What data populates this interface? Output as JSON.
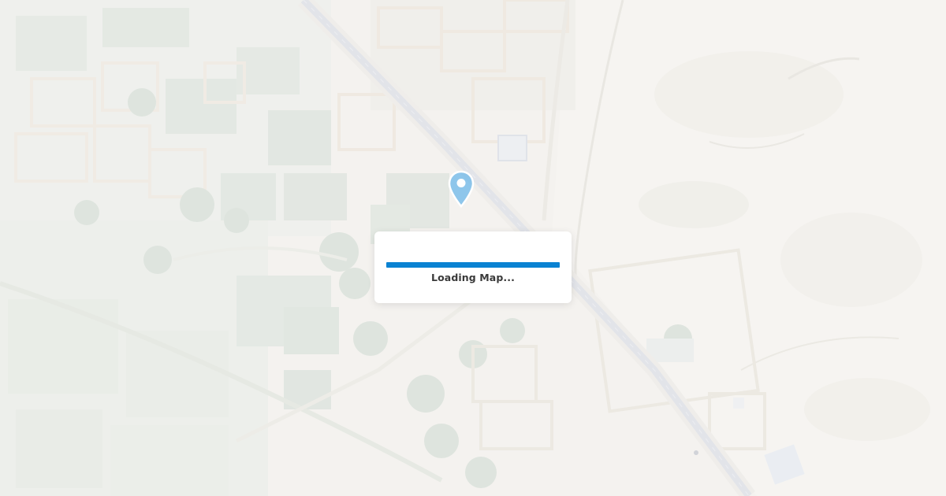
{
  "map": {
    "view": "satellite",
    "marker_icon": "map-pin-icon",
    "marker_color": "#4aa8e8"
  },
  "loading": {
    "label": "Loading Map...",
    "progress_fraction": 1.0,
    "bar_color": "#0a82d2"
  }
}
